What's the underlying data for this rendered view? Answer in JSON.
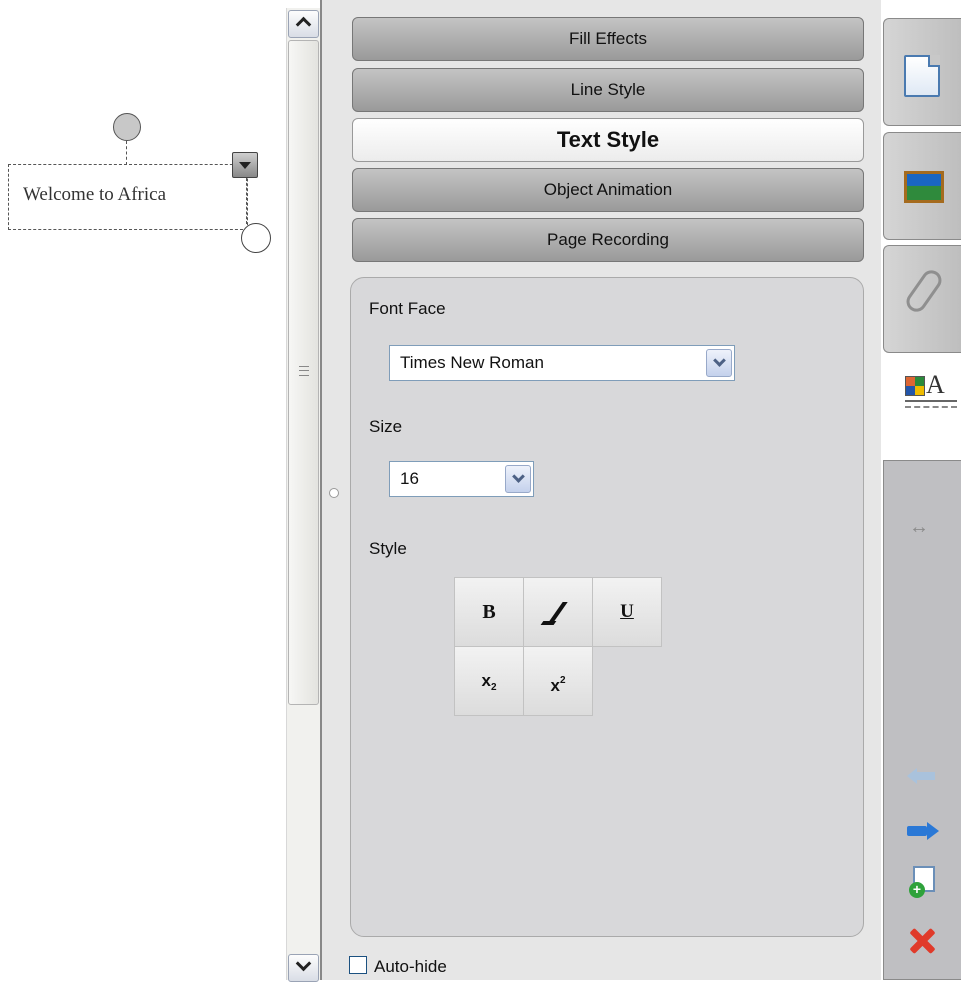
{
  "canvas": {
    "text_object": "Welcome to Africa"
  },
  "panel": {
    "sections": [
      {
        "label": "Fill Effects"
      },
      {
        "label": "Line Style"
      },
      {
        "label": "Text Style"
      },
      {
        "label": "Object Animation"
      },
      {
        "label": "Page Recording"
      }
    ],
    "active_section": "Text Style",
    "font_face_label": "Font Face",
    "font_face_value": "Times New Roman",
    "size_label": "Size",
    "size_value": "16",
    "style_label": "Style",
    "style_buttons": [
      {
        "name": "bold",
        "glyph": "B"
      },
      {
        "name": "italic",
        "glyph": ""
      },
      {
        "name": "underline",
        "glyph": "U"
      },
      {
        "name": "subscript",
        "glyph": "x",
        "sub": "2"
      },
      {
        "name": "superscript",
        "glyph": "x",
        "sup": "2"
      }
    ],
    "autohide_label": "Auto-hide",
    "autohide_checked": false
  },
  "sidebar_tabs": [
    "page-sorter-icon",
    "gallery-icon",
    "attachments-icon",
    "properties-icon"
  ],
  "toolbar_icons": [
    "move-toolbar-icon",
    "previous-page-icon",
    "next-page-icon",
    "add-page-icon",
    "delete-page-icon"
  ],
  "colors": {
    "accordion": "#a8a8a8",
    "panel_bg": "#e6e6e6",
    "props_bg": "#d8d8da",
    "accent_blue": "#2a78d6",
    "delete_red": "#e03a2a"
  }
}
